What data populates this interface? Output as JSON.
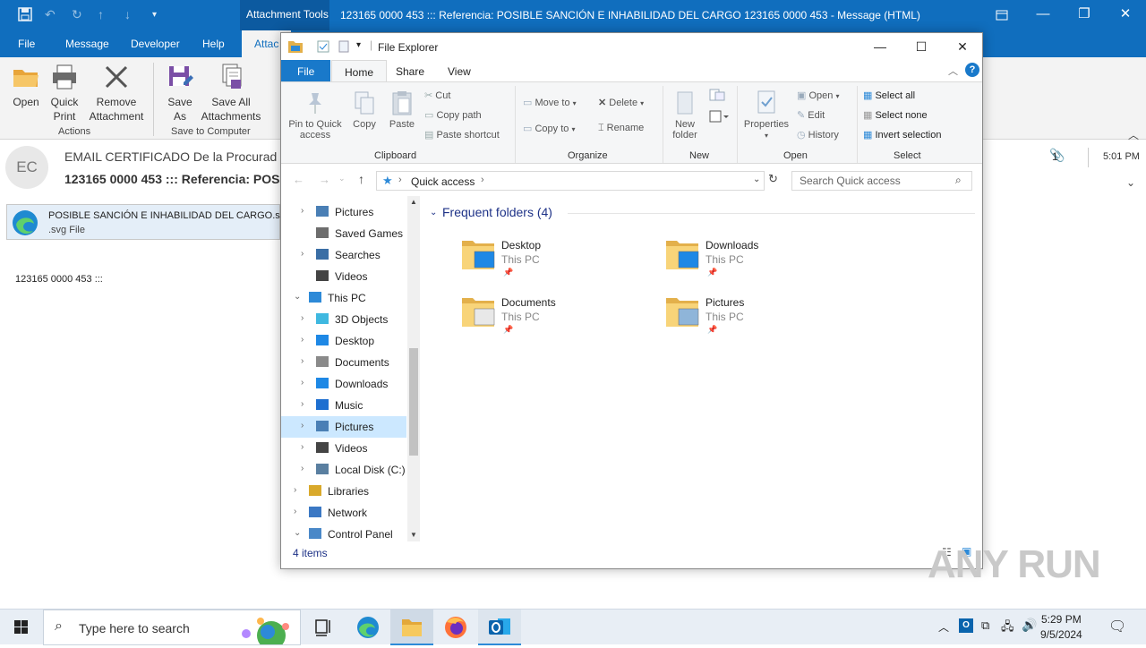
{
  "outlook": {
    "context_tab": "Attachment Tools",
    "window_title": "123165 0000 453 ::: Referencia: POSIBLE SANCIÓN E INHABILIDAD DEL CARGO 123165 0000 453  -  Message (HTML)",
    "menus": [
      "File",
      "Message",
      "Developer",
      "Help",
      "Attac"
    ],
    "ribbon": {
      "open": "Open",
      "quick_print": [
        "Quick",
        "Print"
      ],
      "remove_attachment": [
        "Remove",
        "Attachment"
      ],
      "actions_group": "Actions",
      "save_as": [
        "Save",
        "As"
      ],
      "save_all": [
        "Save All",
        "Attachments"
      ],
      "save_group": "Save to Computer"
    },
    "avatar_initials": "EC",
    "sender": "EMAIL CERTIFICADO De la Procurad",
    "subject": "123165 0000 453 ::: Referencia: POSI",
    "attachment_count": "1",
    "received_time": "5:01 PM",
    "attachment": {
      "name": "POSIBLE SANCIÓN  E INHABILIDAD DEL CARGO.s",
      "type": ".svg File"
    },
    "body": "123165  0000  453  :::"
  },
  "explorer": {
    "title": "File Explorer",
    "tabs": [
      "File",
      "Home",
      "Share",
      "View"
    ],
    "ribbon": {
      "pin": [
        "Pin to Quick",
        "access"
      ],
      "copy": "Copy",
      "paste": "Paste",
      "cut": "Cut",
      "copy_path": "Copy path",
      "paste_shortcut": "Paste shortcut",
      "clipboard_group": "Clipboard",
      "move_to": "Move to",
      "copy_to": "Copy to",
      "delete": "Delete",
      "rename": "Rename",
      "organize_group": "Organize",
      "new_folder": [
        "New",
        "folder"
      ],
      "new_group": "New",
      "properties": "Properties",
      "open": "Open",
      "edit": "Edit",
      "history": "History",
      "open_group": "Open",
      "select_all": "Select all",
      "select_none": "Select none",
      "invert_selection": "Invert selection",
      "select_group": "Select"
    },
    "address": "Quick access",
    "search_placeholder": "Search Quick access",
    "nav": [
      {
        "label": "Pictures",
        "indent": 1,
        "expander": "›",
        "icon": "pictures-icon",
        "color": "#4a7fb5"
      },
      {
        "label": "Saved Games",
        "indent": 1,
        "expander": "",
        "icon": "saved-games-icon",
        "color": "#6d6d6d"
      },
      {
        "label": "Searches",
        "indent": 1,
        "expander": "›",
        "icon": "searches-icon",
        "color": "#3a6ea5"
      },
      {
        "label": "Videos",
        "indent": 1,
        "expander": "",
        "icon": "videos-icon",
        "color": "#444444"
      },
      {
        "label": "This PC",
        "indent": 0,
        "expander": "⌄",
        "icon": "this-pc-icon",
        "color": "#2d8ad8"
      },
      {
        "label": "3D Objects",
        "indent": 1,
        "expander": "›",
        "icon": "3d-objects-icon",
        "color": "#3fb8e0"
      },
      {
        "label": "Desktop",
        "indent": 1,
        "expander": "›",
        "icon": "desktop-icon",
        "color": "#1e88e5"
      },
      {
        "label": "Documents",
        "indent": 1,
        "expander": "›",
        "icon": "documents-icon",
        "color": "#8a8a8a"
      },
      {
        "label": "Downloads",
        "indent": 1,
        "expander": "›",
        "icon": "downloads-icon",
        "color": "#1e88e5"
      },
      {
        "label": "Music",
        "indent": 1,
        "expander": "›",
        "icon": "music-icon",
        "color": "#1e6fd0"
      },
      {
        "label": "Pictures",
        "indent": 1,
        "expander": "›",
        "icon": "pictures-icon",
        "color": "#4a7fb5",
        "selected": true
      },
      {
        "label": "Videos",
        "indent": 1,
        "expander": "›",
        "icon": "videos-icon",
        "color": "#444444"
      },
      {
        "label": "Local Disk (C:)",
        "indent": 1,
        "expander": "›",
        "icon": "local-disk-icon",
        "color": "#5a7fa0"
      },
      {
        "label": "Libraries",
        "indent": 0,
        "expander": "›",
        "icon": "libraries-icon",
        "color": "#d9a92b"
      },
      {
        "label": "Network",
        "indent": 0,
        "expander": "›",
        "icon": "network-icon",
        "color": "#3b78c4"
      },
      {
        "label": "Control Panel",
        "indent": 0,
        "expander": "⌄",
        "icon": "control-panel-icon",
        "color": "#4a88c8"
      }
    ],
    "frequent_header": "Frequent folders (4)",
    "folders": [
      {
        "name": "Desktop",
        "location": "This PC",
        "icon": "desktop-folder-icon",
        "overlay": "#1e88e5"
      },
      {
        "name": "Downloads",
        "location": "This PC",
        "icon": "downloads-folder-icon",
        "overlay": "#1e88e5"
      },
      {
        "name": "Documents",
        "location": "This PC",
        "icon": "documents-folder-icon",
        "overlay": "#e8e8e8"
      },
      {
        "name": "Pictures",
        "location": "This PC",
        "icon": "pictures-folder-icon",
        "overlay": "#8fb5d9"
      }
    ],
    "status": "4 items"
  },
  "taskbar": {
    "search_placeholder": "Type here to search",
    "time": "5:29 PM",
    "date": "9/5/2024"
  },
  "watermark": "ANY RUN",
  "colors": {
    "outlook_blue": "#106ebe",
    "explorer_file_tab": "#1979ca",
    "selection": "#cce8ff"
  }
}
